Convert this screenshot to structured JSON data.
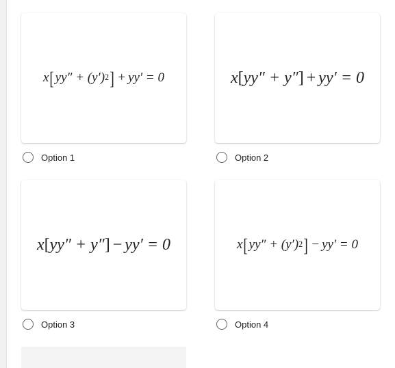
{
  "options": [
    {
      "label": "Option 1",
      "selected": false,
      "equation": {
        "pre": "x",
        "inner_a": "yy″ + (y′)",
        "inner_sup": "2",
        "op": "+",
        "post": "yy′ = 0",
        "brackets": "large"
      }
    },
    {
      "label": "Option 2",
      "selected": false,
      "equation": {
        "pre": "x",
        "inner_a": "yy″ + y″",
        "op": "+",
        "post": "yy′ = 0",
        "brackets": "plain"
      }
    },
    {
      "label": "Option 3",
      "selected": false,
      "equation": {
        "pre": "x",
        "inner_a": "yy″ + y″",
        "op": "−",
        "post": "yy′ = 0",
        "brackets": "plain"
      }
    },
    {
      "label": "Option 4",
      "selected": false,
      "equation": {
        "pre": "x",
        "inner_a": "yy″ + (y′)",
        "inner_sup": "2",
        "op": "−",
        "post": "yy′ = 0",
        "brackets": "large"
      }
    }
  ],
  "colors": {
    "background": "#ffffff",
    "card": "#ffffff",
    "radio_border": "#5f6368",
    "label_text": "#202124",
    "equation_text": "#222222",
    "left_strip": "#f1f1f1",
    "placeholder_block": "#f3f3f3"
  }
}
